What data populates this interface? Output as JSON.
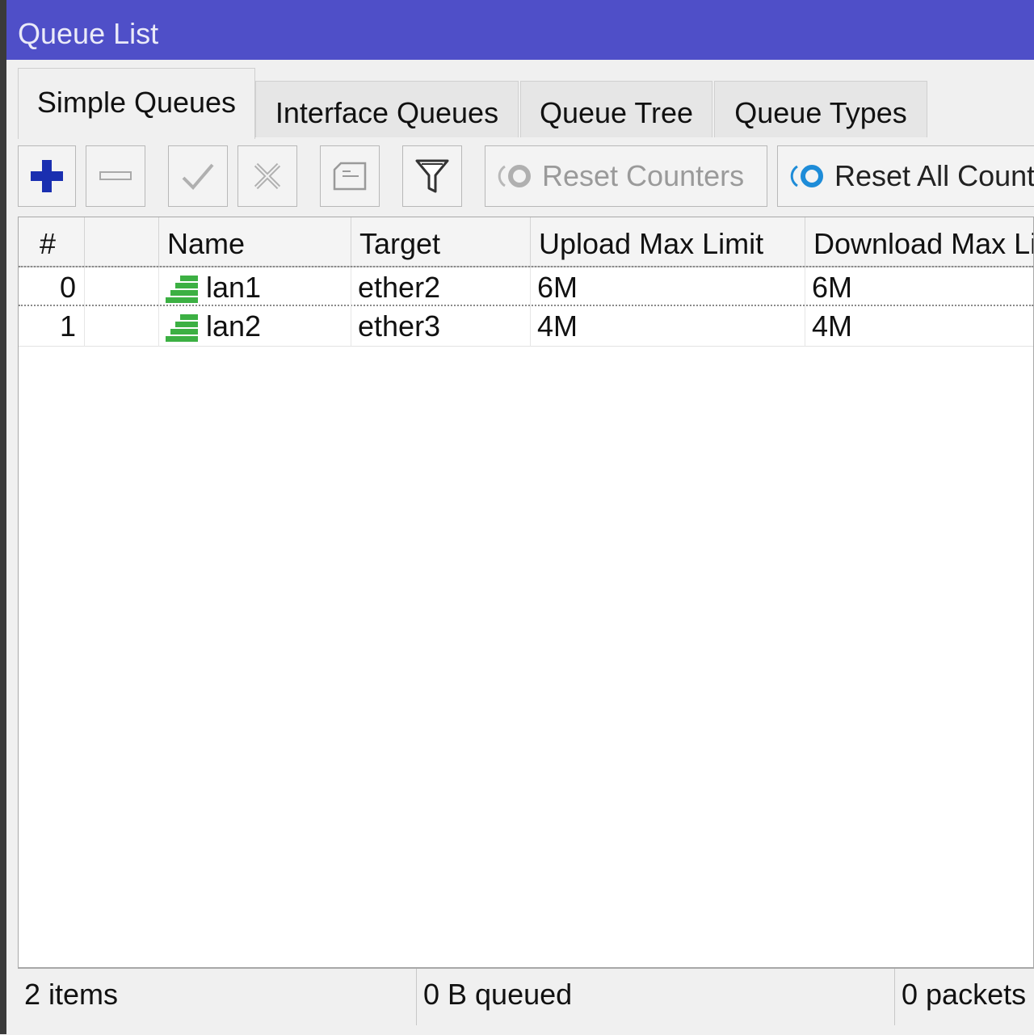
{
  "window": {
    "title": "Queue List"
  },
  "tabs": [
    {
      "label": "Simple Queues",
      "active": true
    },
    {
      "label": "Interface Queues",
      "active": false
    },
    {
      "label": "Queue Tree",
      "active": false
    },
    {
      "label": "Queue Types",
      "active": false
    }
  ],
  "toolbar": {
    "add_icon": "plus-icon",
    "remove_icon": "minus-icon",
    "enable_icon": "checkmark-icon",
    "disable_icon": "x-icon",
    "comment_icon": "comment-icon",
    "filter_icon": "filter-icon",
    "reset_counters_label": "Reset Counters",
    "reset_all_counters_label": "Reset All Count"
  },
  "table": {
    "columns": [
      "#",
      "",
      "Name",
      "Target",
      "Upload Max Limit",
      "Download Max Li"
    ],
    "rows": [
      {
        "num": "0",
        "name": "lan1",
        "target": "ether2",
        "upload": "6M",
        "download": "6M"
      },
      {
        "num": "1",
        "name": "lan2",
        "target": "ether3",
        "upload": "4M",
        "download": "4M"
      }
    ]
  },
  "status": {
    "items": "2 items",
    "queued": "0 B queued",
    "packets": "0 packets"
  },
  "colors": {
    "titlebar": "#4f4fc8",
    "add_icon": "#1a2fb0",
    "queue_icon": "#3cb043"
  }
}
